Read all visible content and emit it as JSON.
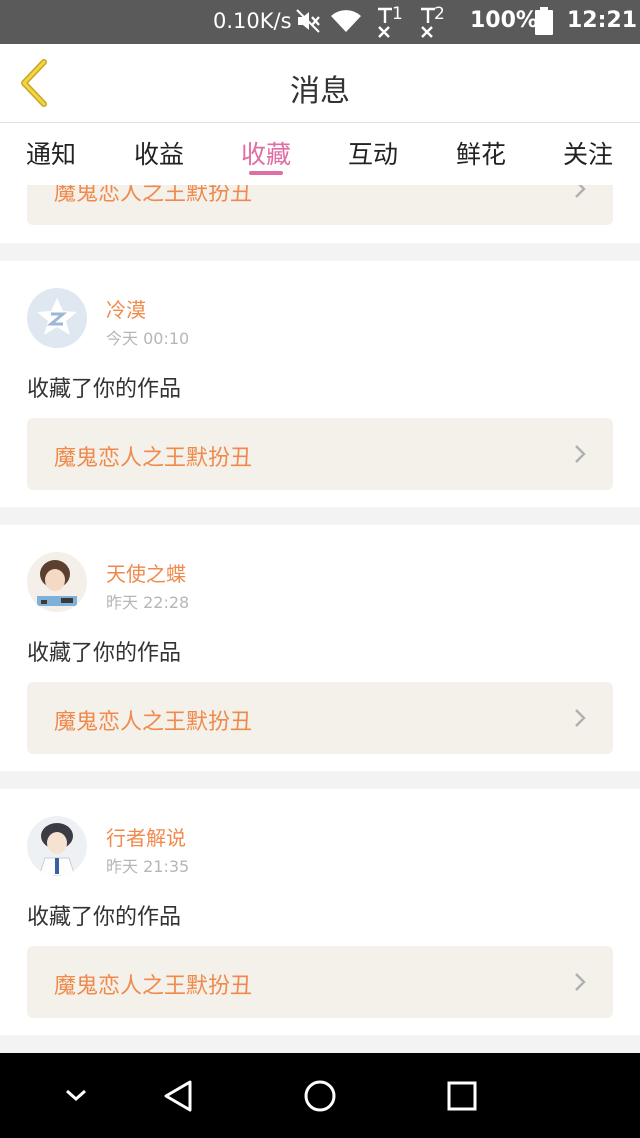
{
  "status_bar": {
    "net_speed": "0.10K/s",
    "sim1": "1",
    "sim2": "2",
    "battery": "100%",
    "time": "12:21"
  },
  "header": {
    "title": "消息"
  },
  "tabs": [
    {
      "label": "通知"
    },
    {
      "label": "收益"
    },
    {
      "label": "收藏",
      "active": true
    },
    {
      "label": "互动"
    },
    {
      "label": "鲜花"
    },
    {
      "label": "关注"
    }
  ],
  "partial_card": {
    "work_title": "魔鬼恋人之王默扮丑"
  },
  "items": [
    {
      "user": "冷漠",
      "time": "今天 00:10",
      "message": "收藏了你的作品",
      "work_title": "魔鬼恋人之王默扮丑"
    },
    {
      "user": "天使之蝶",
      "time": "昨天 22:28",
      "message": "收藏了你的作品",
      "work_title": "魔鬼恋人之王默扮丑"
    },
    {
      "user": "行者解说",
      "time": "昨天 21:35",
      "message": "收藏了你的作品",
      "work_title": "魔鬼恋人之王默扮丑"
    }
  ],
  "colors": {
    "accent": "#e06da3",
    "user_name": "#f08a4c",
    "link_bg": "#f3f1ea"
  },
  "icons": [
    "back-icon",
    "chevron-right-icon",
    "nav-collapse-icon",
    "nav-back-icon",
    "nav-home-icon",
    "nav-recents-icon"
  ]
}
